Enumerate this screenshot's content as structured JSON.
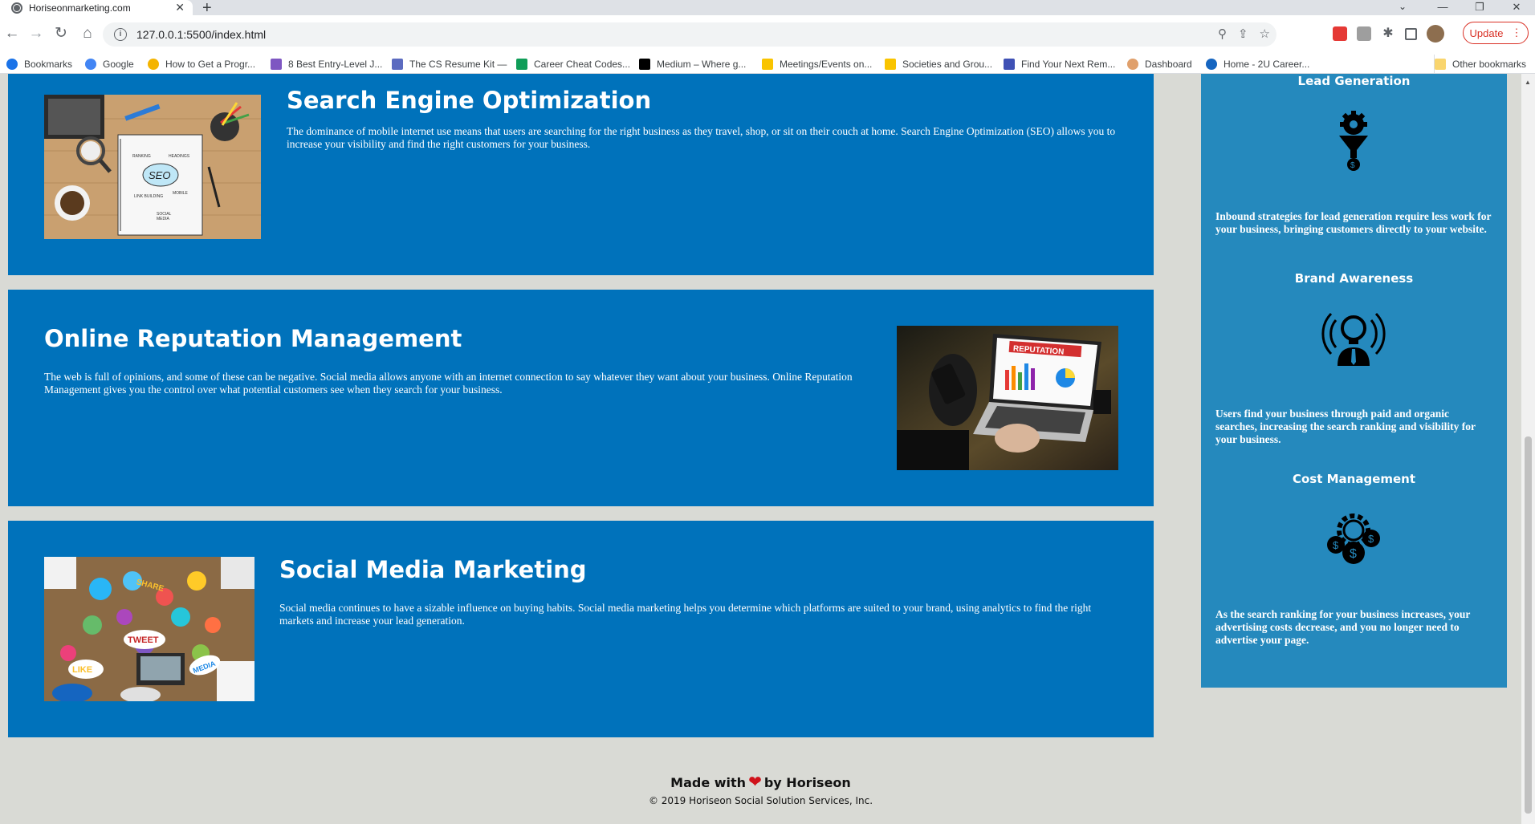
{
  "browser": {
    "tab_title": "Horiseonmarketing.com",
    "url": "127.0.0.1:5500/index.html",
    "update_label": "Update",
    "bookmarks": [
      {
        "label": "Bookmarks",
        "icon": "star-icon",
        "color": "#1a73e8"
      },
      {
        "label": "Google",
        "icon": "google-icon",
        "color": "#4285f4"
      },
      {
        "label": "How to Get a Progr...",
        "icon": "s-icon",
        "color": "#f4b400"
      },
      {
        "label": "8 Best Entry-Level J...",
        "icon": "bird-icon",
        "color": "#7e57c2"
      },
      {
        "label": "The CS Resume Kit —",
        "icon": "doc-icon",
        "color": "#5c6bc0"
      },
      {
        "label": "Career Cheat Codes...",
        "icon": "sheet-icon",
        "color": "#0f9d58"
      },
      {
        "label": "Medium – Where g...",
        "icon": "medium-icon",
        "color": "#000000"
      },
      {
        "label": "Meetings/Events on...",
        "icon": "k-icon",
        "color": "#f9c400"
      },
      {
        "label": "Societies and Grou...",
        "icon": "k-icon",
        "color": "#f9c400"
      },
      {
        "label": "Find Your Next Rem...",
        "icon": "w-icon",
        "color": "#3f51b5"
      },
      {
        "label": "Dashboard",
        "icon": "dashboard-icon",
        "color": "#e0a06c"
      },
      {
        "label": "Home - 2U Career...",
        "icon": "2u-icon",
        "color": "#1565c0"
      }
    ],
    "other_bookmarks": "Other bookmarks"
  },
  "services": [
    {
      "title": "Search Engine Optimization",
      "text": "The dominance of mobile internet use means that users are searching for the right business as they travel, shop, or sit on their couch at home. Search Engine Optimization (SEO) allows you to increase your visibility and find the right customers for your business.",
      "image": "seo-notebook-image"
    },
    {
      "title": "Online Reputation Management",
      "text": "The web is full of opinions, and some of these can be negative. Social media allows anyone with an internet connection to say whatever they want about your business. Online Reputation Management gives you the control over what potential customers see when they search for your business.",
      "image": "reputation-laptop-image",
      "image_label": "REPUTATION"
    },
    {
      "title": "Social Media Marketing",
      "text": "Social media continues to have a sizable influence on buying habits. Social media marketing helps you determine which platforms are suited to your brand, using analytics to find the right markets and increase your lead generation.",
      "image": "social-media-table-image",
      "image_words": [
        "SHARE",
        "TWEET",
        "LIKE",
        "MEDIA"
      ]
    }
  ],
  "benefits": [
    {
      "title": "Lead Generation",
      "icon": "funnel-gear-icon",
      "text": "Inbound strategies for lead generation require less work for your business, bringing customers directly to your website."
    },
    {
      "title": "Brand Awareness",
      "icon": "lightbulb-person-icon",
      "text": "Users find your business through paid and organic searches, increasing the search ranking and visibility for your business."
    },
    {
      "title": "Cost Management",
      "icon": "gear-dollar-icon",
      "text": "As the search ranking for your business increases, your advertising costs decrease, and you no longer need to advertise your page."
    }
  ],
  "footer": {
    "made_with": "Made with",
    "by": "by Horiseon",
    "copyright": "© 2019 Horiseon Social Solution Services, Inc."
  },
  "colors": {
    "service_bg": "#0072bb",
    "sidebar_bg": "#2589bd",
    "page_bg": "#d9dad5",
    "heart": "#d0121b"
  }
}
